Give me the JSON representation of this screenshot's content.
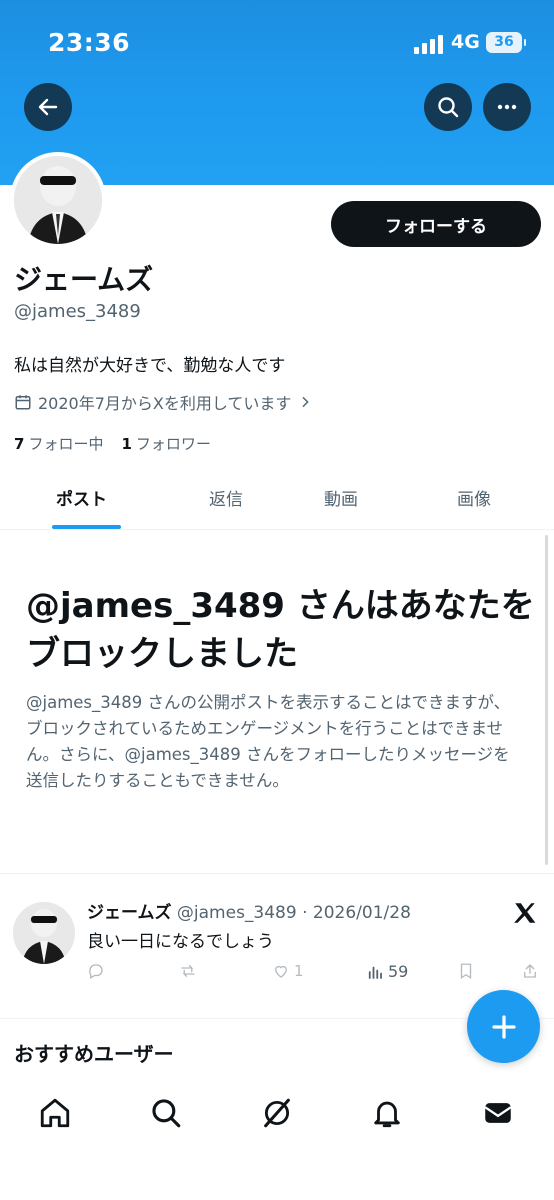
{
  "status_bar": {
    "time": "23:36",
    "network": "4G",
    "battery": "36"
  },
  "colors": {
    "accent": "#1d9bf0",
    "banner": "#1e9bf0",
    "text": "#0f1419",
    "muted": "#536471"
  },
  "header_icons": {
    "back": "arrow-left-icon",
    "search": "search-icon",
    "more": "more-horizontal-icon"
  },
  "profile": {
    "follow_label": "フォローする",
    "name": "ジェームズ",
    "handle": "@james_3489",
    "bio": "私は自然が大好きで、勤勉な人です",
    "joined": "2020年7月からXを利用しています",
    "following_count": "7",
    "following_label": "フォロー中",
    "followers_count": "1",
    "followers_label": "フォロワー"
  },
  "tabs": [
    {
      "label": "ポスト",
      "active": true
    },
    {
      "label": "返信"
    },
    {
      "label": "動画"
    },
    {
      "label": "画像"
    }
  ],
  "blocked_notice": {
    "title": "@james_3489 さんはあなたをブロックしました",
    "description": "@james_3489 さんの公開ポストを表示することはできますが、ブロックされているためエンゲージメントを行うことはできません。さらに、@james_3489 さんをフォローしたりメッセージを送信したりすることもできません。"
  },
  "post": {
    "author": "ジェームズ",
    "handle_date": "@james_3489 · 2026/01/28",
    "text": "良い一日になるでしょう",
    "likes": "1",
    "views": "59"
  },
  "recommend_heading": "おすすめユーザー",
  "bottom_nav": [
    "home-icon",
    "search-icon",
    "grok-icon",
    "notifications-icon",
    "messages-icon"
  ]
}
